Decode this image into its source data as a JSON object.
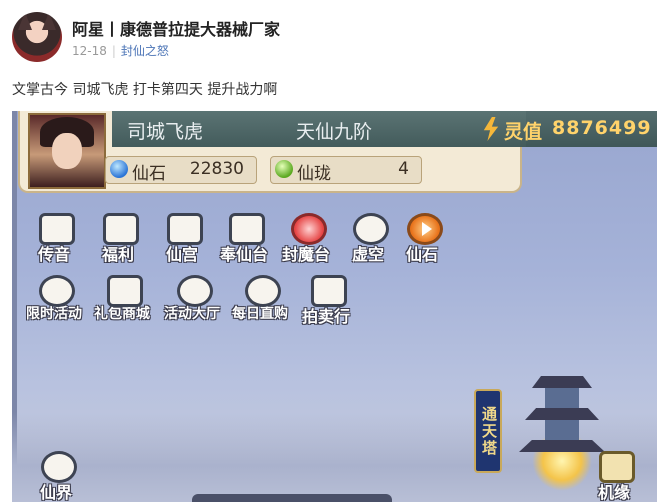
{
  "post": {
    "username": "阿星丨康德普拉提大器械厂家",
    "date": "12-18",
    "topic": "封仙之怒",
    "text": "文掌古今 司城飞虎 打卡第四天 提升战力啊"
  },
  "game": {
    "player_name": "司城飞虎",
    "rank": "天仙九阶",
    "lingzhi_label": "灵值",
    "lingzhi_value": "8876499",
    "resources": [
      {
        "label": "仙石",
        "value": "22830",
        "icon": "gem-icon"
      },
      {
        "label": "仙珑",
        "value": "4",
        "icon": "jade-ring-icon"
      }
    ],
    "functions_row1": [
      "传音",
      "福利",
      "仙宫",
      "奉仙台",
      "封魔台",
      "虚空",
      "仙石"
    ],
    "functions_row2": [
      "限时活动",
      "礼包商城",
      "活动大厅",
      "每日直购",
      "拍卖行"
    ],
    "bottom_left": "仙界",
    "bottom_right": "机缘",
    "tower_sign": "通天塔"
  }
}
